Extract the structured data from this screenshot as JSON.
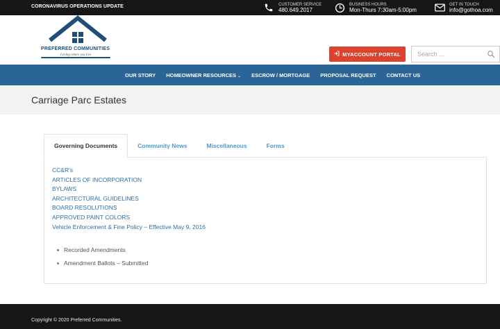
{
  "topbar": {
    "update_label": "CORONAVIRUS OPERATIONS UPDATE",
    "customer_service": {
      "label": "CUSTOMER SERVICE",
      "value": "480.649.2017",
      "icon": "phone-icon"
    },
    "business_hours": {
      "label": "BUSINESS HOURS",
      "value": "Mon-Thurs 7:30am-5:00pm",
      "icon": "clock-icon"
    },
    "get_in_touch": {
      "label": "GET IN TOUCH",
      "value": "info@gothoa.com",
      "icon": "mail-icon"
    }
  },
  "header": {
    "logo": {
      "brand": "PREFERRED COMMUNITIES",
      "tagline": "Loving where you live"
    },
    "portal_button": "MYACCOUNT PORTAL",
    "search_placeholder": "Search ..."
  },
  "nav": {
    "items": [
      {
        "label": "OUR STORY"
      },
      {
        "label": "HOMEOWNER RESOURCES",
        "has_dropdown": true
      },
      {
        "label": "ESCROW / MORTGAGE"
      },
      {
        "label": "PROPOSAL REQUEST"
      },
      {
        "label": "CONTACT US"
      }
    ]
  },
  "page": {
    "title": "Carriage Parc Estates"
  },
  "tabs": {
    "items": [
      {
        "label": "Governing Documents",
        "active": true
      },
      {
        "label": "Community News"
      },
      {
        "label": "Miscellaneous"
      },
      {
        "label": "Forms"
      }
    ]
  },
  "documents": [
    "CC&R's",
    "ARTICLES OF INCORPORATION",
    "BYLAWS",
    "ARCHITECTURAL GUIDELINES",
    "BOARD RESOLUTIONS",
    "APPROVED PAINT COLORS",
    "Vehicle Enforcement & Fine Policy – Effective May 9, 2016"
  ],
  "sub_documents": [
    "Recorded Amendments",
    "Amendment Ballots – Submitted"
  ],
  "footer": {
    "copyright": "Copyright © 2020 Preferred Communities."
  },
  "colors": {
    "topbar": "#161616",
    "nav": "#2b6496",
    "portal_button": "#d9432f",
    "link": "#2e6fa3",
    "tab_link": "#4a9bd1"
  }
}
